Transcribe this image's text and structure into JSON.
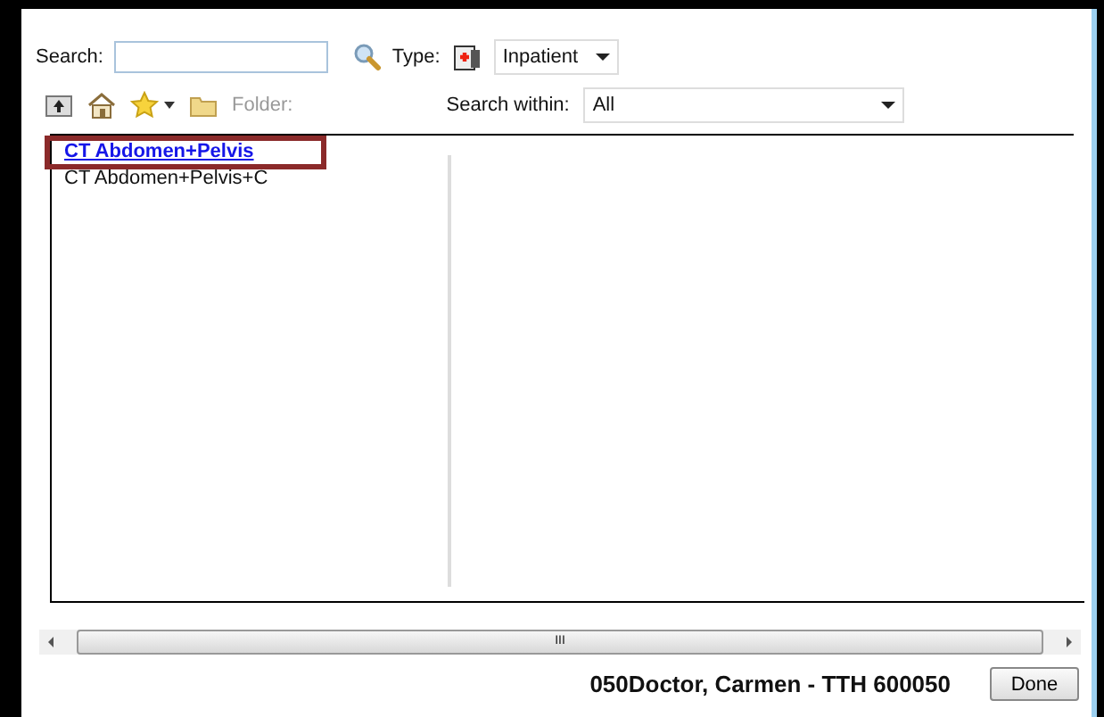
{
  "search": {
    "label": "Search:"
  },
  "type": {
    "label": "Type:",
    "value": "Inpatient"
  },
  "toolbar": {
    "folder_label": "Folder:",
    "search_within_label": "Search within:",
    "search_within_value": "All"
  },
  "results": [
    {
      "label": "CT Abdomen+Pelvis",
      "selected": true
    },
    {
      "label": "CT Abdomen+Pelvis+C",
      "selected": false
    }
  ],
  "scrollbar_grip": "III",
  "status": "050Doctor, Carmen - TTH 600050",
  "done_button": "Done"
}
